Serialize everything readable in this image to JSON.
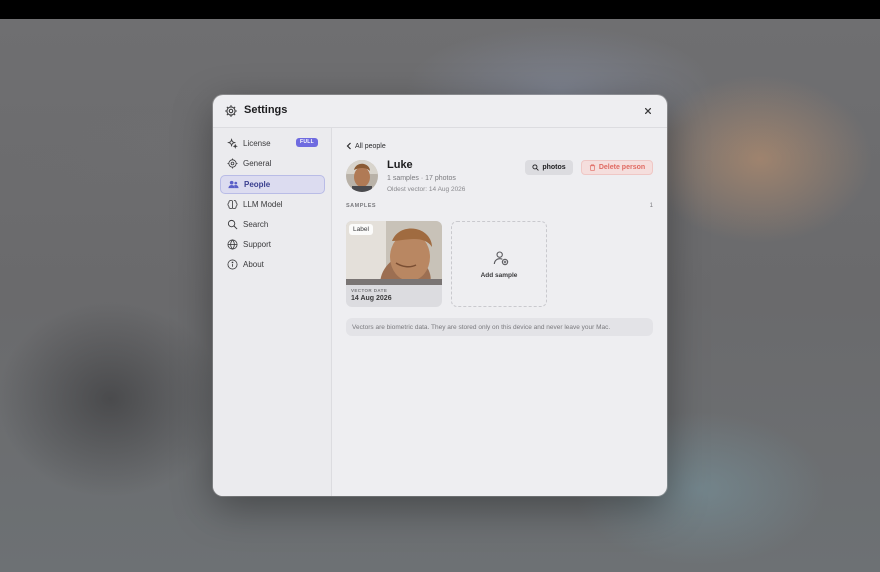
{
  "window": {
    "title": "Settings",
    "accent": "#6f6be0"
  },
  "sidebar": {
    "items": [
      {
        "label": "License",
        "icon": "sparkle-icon",
        "badge": "FULL"
      },
      {
        "label": "General",
        "icon": "gear-icon"
      },
      {
        "label": "People",
        "icon": "people-icon",
        "active": true
      },
      {
        "label": "LLM Model",
        "icon": "brain-icon"
      },
      {
        "label": "Search",
        "icon": "search-icon"
      },
      {
        "label": "Support",
        "icon": "globe-icon"
      },
      {
        "label": "About",
        "icon": "info-icon"
      }
    ]
  },
  "main": {
    "back_label": "All people",
    "person": {
      "name": "Luke",
      "summary": "1 samples · 17 photos",
      "oldest": "Oldest vector: 14 Aug 2026"
    },
    "buttons": {
      "photos": "photos",
      "delete": "Delete person",
      "delete_color": "#e06a62"
    },
    "samples_section": {
      "label": "SAMPLES",
      "count": "1"
    },
    "sample": {
      "tag": "Label",
      "meta_label": "VECTOR DATE",
      "meta_date": "14 Aug 2026"
    },
    "add_sample": "Add sample",
    "notice": "Vectors are biometric data. They are stored only on this device and never leave your Mac."
  }
}
